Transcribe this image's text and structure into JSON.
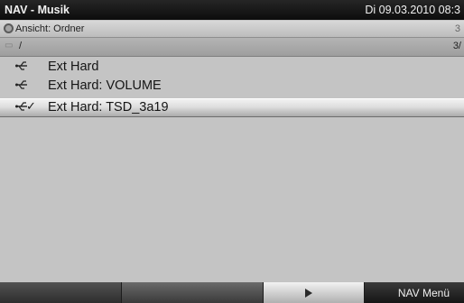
{
  "header": {
    "title": "NAV - Musik",
    "datetime": "Di 09.03.2010 08:3"
  },
  "view": {
    "icon": "ring-icon",
    "label": "Ansicht: Ordner",
    "edge_text": "3"
  },
  "pathbar": {
    "icon": "folder-icon",
    "path": "/",
    "page_indicator": "3/"
  },
  "items": [
    {
      "label": "Ext Hard",
      "icon": "usb-icon",
      "selected": false
    },
    {
      "label": "Ext Hard: VOLUME",
      "icon": "usb-icon",
      "selected": false
    },
    {
      "label": "Ext Hard: TSD_3a19",
      "icon": "usb-icon",
      "check": "✓",
      "selected": true
    }
  ],
  "footer": {
    "play_icon": "play-icon",
    "menu_label": "NAV Menü"
  },
  "colors": {
    "titlebar": "#0c0c0c",
    "background": "#c4c4c4",
    "selection": "#dedede"
  }
}
